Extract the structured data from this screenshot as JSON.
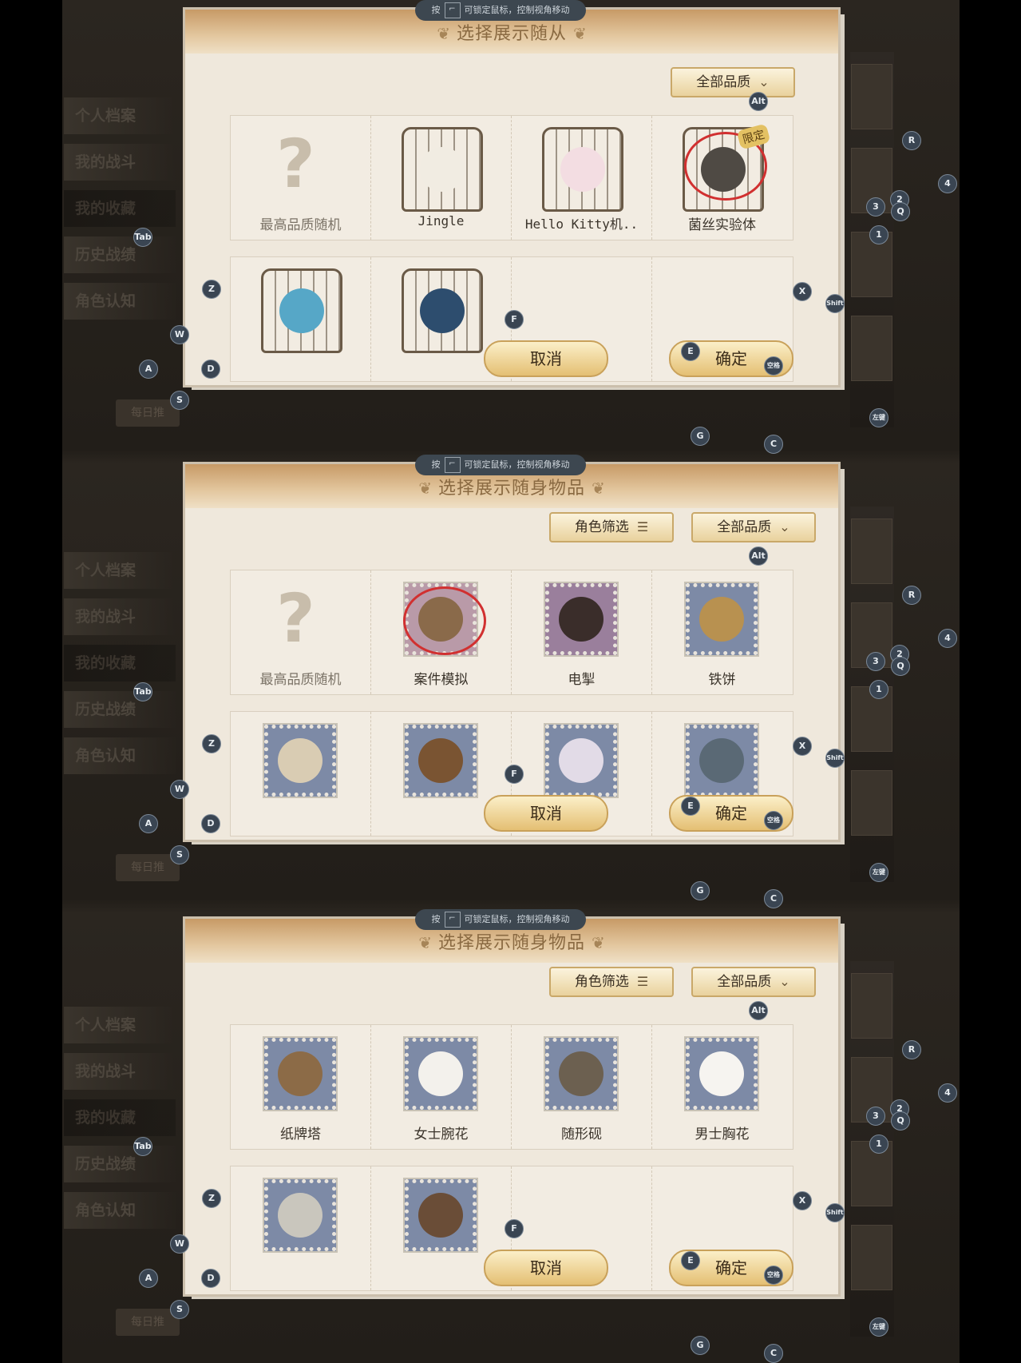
{
  "screens": [
    {
      "title": "选择展示随从",
      "hint": "可锁定鼠标，控制视角移动",
      "hint_prefix": "按",
      "filter_label": "",
      "quality_label": "全部品质",
      "cancel": "取消",
      "confirm": "确定",
      "rows": [
        [
          {
            "label": "最高品质随机",
            "icon": "question-mark",
            "highlight": false
          },
          {
            "label": "Jingle",
            "icon": "white-dog-cage",
            "highlight": false
          },
          {
            "label": "Hello Kitty机..",
            "icon": "hello-kitty-cage",
            "highlight": false
          },
          {
            "label": "菌丝实验体",
            "icon": "mycelium-cage",
            "highlight": true,
            "badge": "限定"
          }
        ],
        [
          {
            "label": "",
            "icon": "blue-bird-cage",
            "highlight": false
          },
          {
            "label": "",
            "icon": "drone-cage",
            "highlight": false
          },
          {
            "label": "",
            "icon": "",
            "highlight": false
          },
          {
            "label": "",
            "icon": "",
            "highlight": false
          }
        ]
      ]
    },
    {
      "title": "选择展示随身物品",
      "hint": "可锁定鼠标，控制视角移动",
      "hint_prefix": "按",
      "filter_label": "角色筛选",
      "quality_label": "全部品质",
      "cancel": "取消",
      "confirm": "确定",
      "rows": [
        [
          {
            "label": "最高品质随机",
            "icon": "question-mark",
            "highlight": false
          },
          {
            "label": "案件模拟",
            "icon": "dartboard-stamp",
            "highlight": true
          },
          {
            "label": "电掣",
            "icon": "lightning-claw-stamp",
            "highlight": false
          },
          {
            "label": "铁饼",
            "icon": "discus-stamp",
            "highlight": false
          }
        ],
        [
          {
            "label": "",
            "icon": "box-stamp",
            "highlight": false
          },
          {
            "label": "",
            "icon": "frame-stamp",
            "highlight": false
          },
          {
            "label": "",
            "icon": "perfume-stamp",
            "highlight": false
          },
          {
            "label": "",
            "icon": "bell-jar-stamp",
            "highlight": false
          }
        ]
      ]
    },
    {
      "title": "选择展示随身物品",
      "hint": "可锁定鼠标，控制视角移动",
      "hint_prefix": "按",
      "filter_label": "角色筛选",
      "quality_label": "全部品质",
      "cancel": "取消",
      "confirm": "确定",
      "rows": [
        [
          {
            "label": "纸牌塔",
            "icon": "card-tower-stamp",
            "highlight": false
          },
          {
            "label": "女士腕花",
            "icon": "wrist-corsage-stamp",
            "highlight": false
          },
          {
            "label": "随形砚",
            "icon": "inkstone-stamp",
            "highlight": false
          },
          {
            "label": "男士胸花",
            "icon": "boutonniere-stamp",
            "highlight": false
          }
        ],
        [
          {
            "label": "",
            "icon": "vase-stamp",
            "highlight": false
          },
          {
            "label": "",
            "icon": "doll-stamp",
            "highlight": false
          },
          {
            "label": "",
            "icon": "",
            "highlight": false
          },
          {
            "label": "",
            "icon": "",
            "highlight": false
          }
        ]
      ]
    }
  ],
  "side_nav": [
    "个人档案",
    "我的战斗",
    "我的收藏",
    "历史战绩",
    "角色认知"
  ],
  "daily": "每日推",
  "keys": {
    "alt": "Alt",
    "r": "R",
    "four": "4",
    "two": "2",
    "three": "3",
    "q": "Q",
    "one": "1",
    "tab": "Tab",
    "z": "Z",
    "x": "X",
    "shift": "Shift",
    "w": "W",
    "f": "F",
    "a": "A",
    "d": "D",
    "e": "E",
    "space": "空格",
    "s": "S",
    "leftclick": "左键",
    "g": "G",
    "c": "C"
  }
}
